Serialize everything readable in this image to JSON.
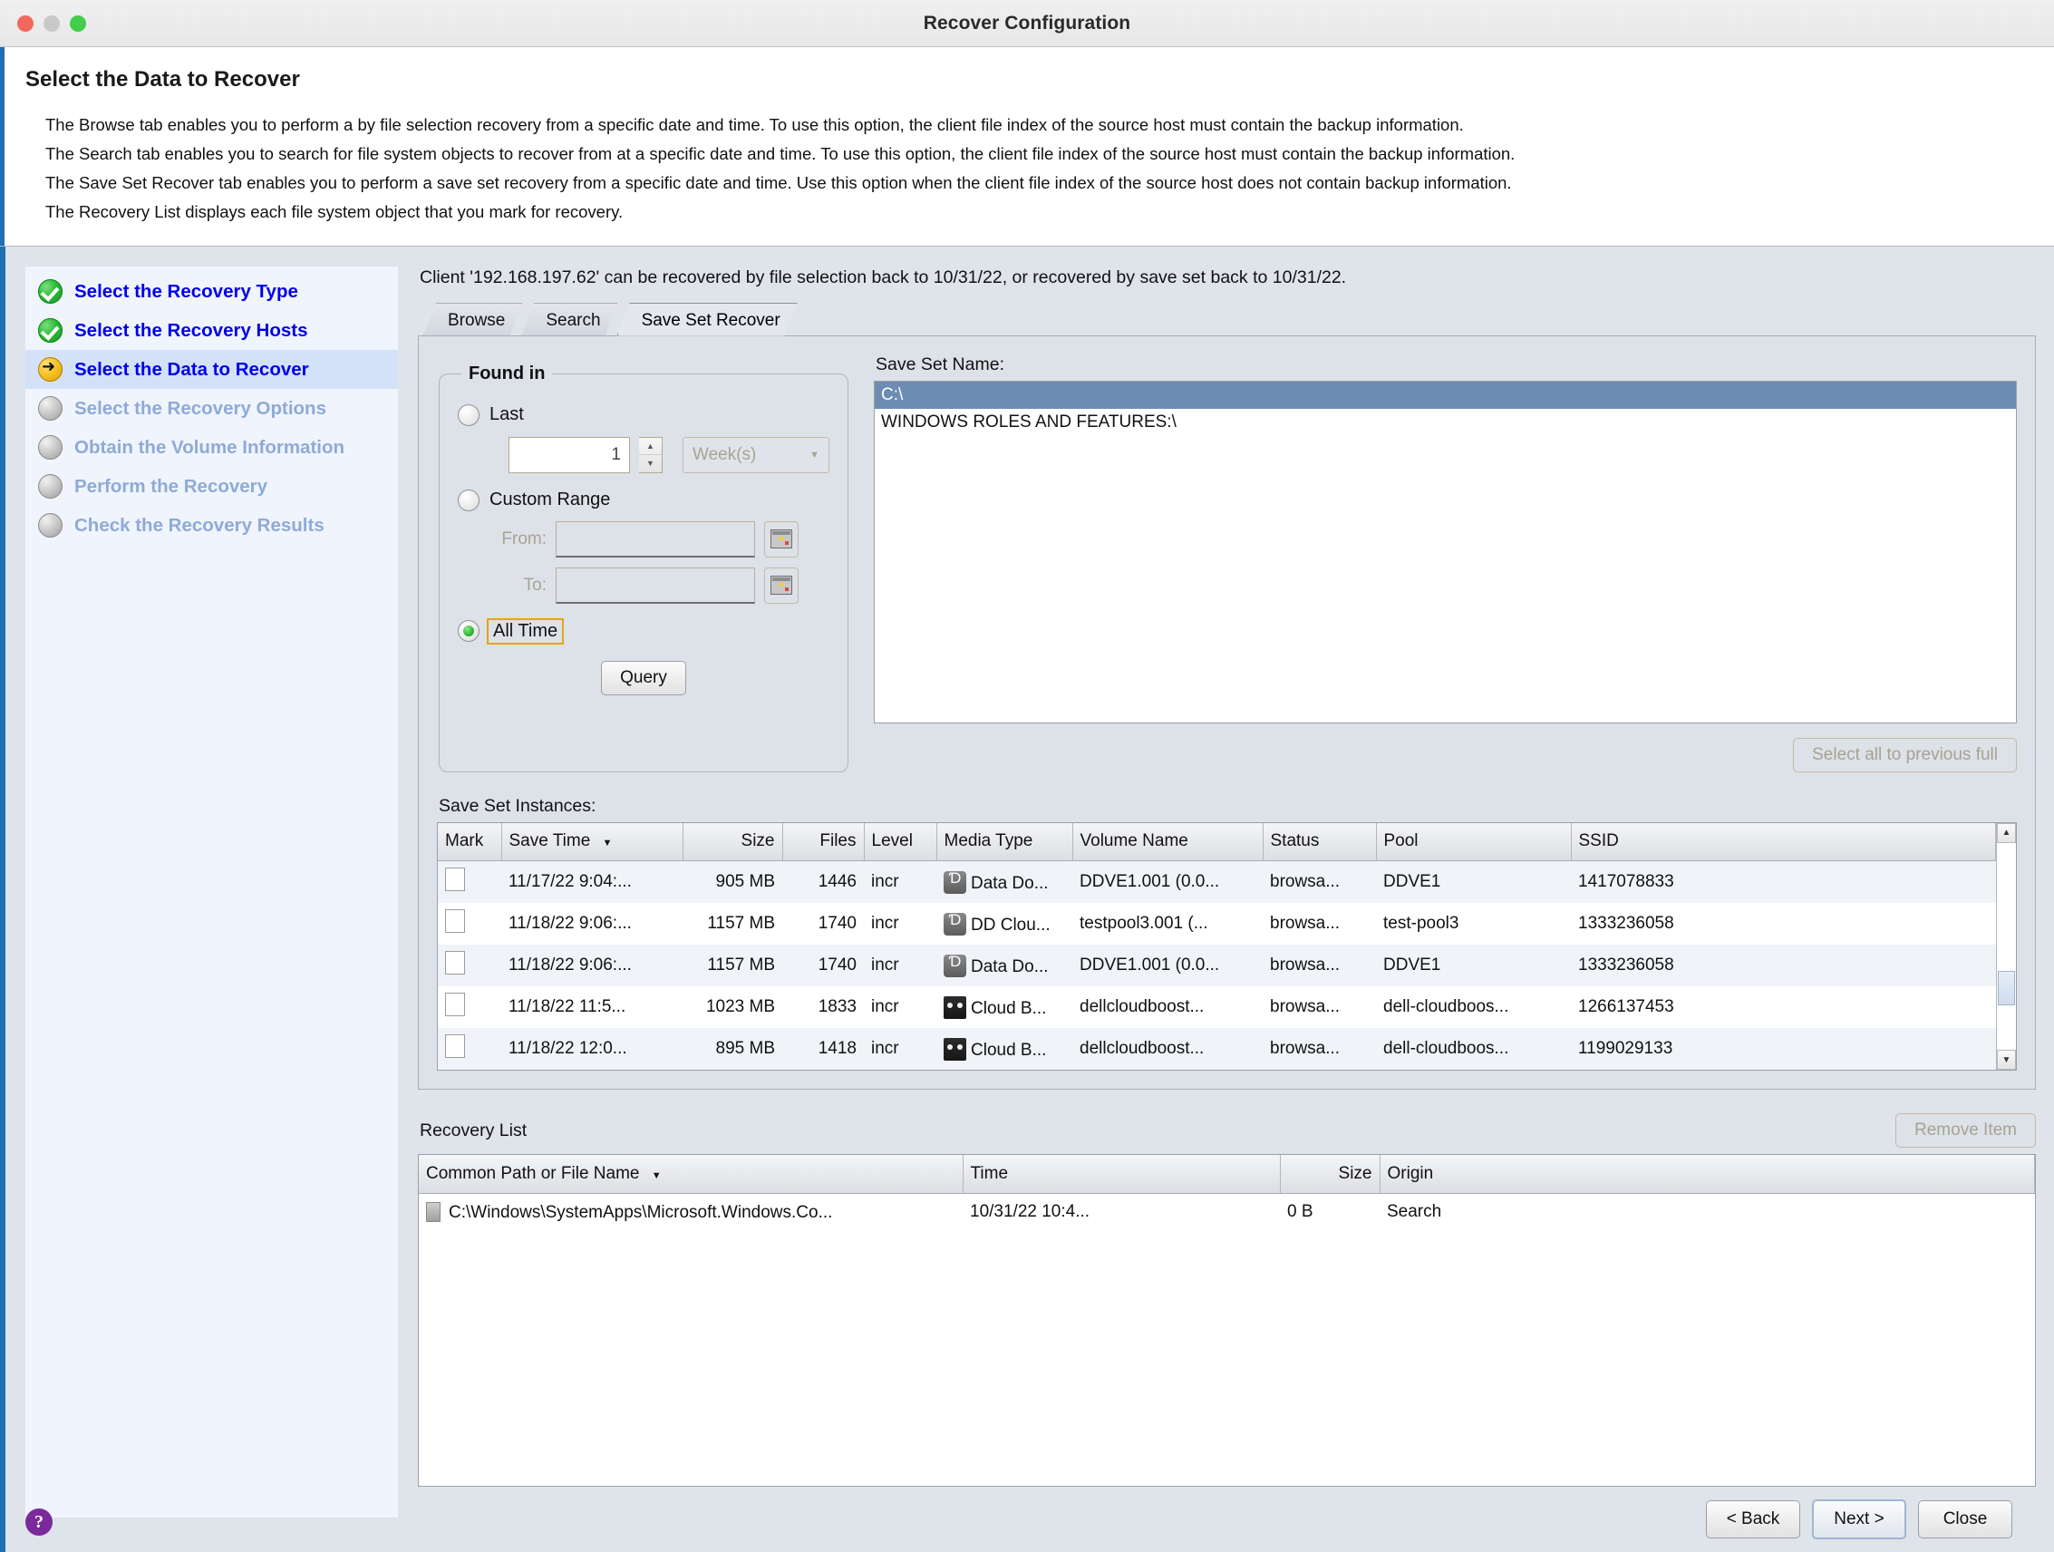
{
  "window": {
    "title": "Recover Configuration"
  },
  "header": {
    "page_title": "Select the Data to Recover",
    "descriptions": [
      "The Browse tab enables you to perform a by file selection recovery from a specific date and time. To use this option, the client file index of the source host must contain the backup information.",
      "The Search tab enables you to search for file system objects to recover from at a specific date and time. To use this option, the client file index of the source host must contain the backup information.",
      "The Save Set Recover tab enables you to perform a save set recovery from a specific date and time.  Use this option when the client file index of the source host does not contain backup information.",
      "The Recovery List displays each file system object that you mark for recovery."
    ]
  },
  "sidebar": {
    "items": [
      {
        "label": "Select the Recovery Type",
        "state": "done"
      },
      {
        "label": "Select the Recovery Hosts",
        "state": "done"
      },
      {
        "label": "Select the Data to Recover",
        "state": "active"
      },
      {
        "label": "Select the Recovery Options",
        "state": "pending"
      },
      {
        "label": "Obtain the Volume Information",
        "state": "pending"
      },
      {
        "label": "Perform the Recovery",
        "state": "pending"
      },
      {
        "label": "Check the Recovery Results",
        "state": "pending"
      }
    ],
    "help_glyph": "?"
  },
  "main": {
    "client_line": "Client '192.168.197.62' can be recovered by file selection back to 10/31/22, or recovered by save set back to 10/31/22.",
    "tabs": [
      {
        "label": "Browse",
        "active": false
      },
      {
        "label": "Search",
        "active": false
      },
      {
        "label": "Save Set Recover",
        "active": true
      }
    ],
    "found_in": {
      "legend": "Found in",
      "last_label": "Last",
      "last_value": "1",
      "unit_value": "Week(s)",
      "custom_range_label": "Custom Range",
      "from_label": "From:",
      "from_value": "",
      "to_label": "To:",
      "to_value": "",
      "all_time_label": "All Time",
      "selected": "All Time",
      "query_button": "Query"
    },
    "save_set_name": {
      "label": "Save Set Name:",
      "items": [
        "C:\\",
        "WINDOWS ROLES AND FEATURES:\\"
      ],
      "selected_index": 0
    },
    "select_all_button": "Select all to previous full",
    "instances": {
      "label": "Save Set Instances:",
      "columns": [
        "Mark",
        "Save Time",
        "Size",
        "Files",
        "Level",
        "Media Type",
        "Volume Name",
        "Status",
        "Pool",
        "SSID"
      ],
      "sort_column": "Save Time",
      "sort_arrow": "▼",
      "rows": [
        {
          "mark": false,
          "save_time": "11/17/22 9:04:...",
          "size": "905 MB",
          "files": "1446",
          "level": "incr",
          "media_type": "Data Do...",
          "media_icon": "dd-icon",
          "volume_name": "DDVE1.001 (0.0...",
          "status": "browsa...",
          "pool": "DDVE1",
          "ssid": "1417078833"
        },
        {
          "mark": false,
          "save_time": "11/18/22 9:06:...",
          "size": "1157 MB",
          "files": "1740",
          "level": "incr",
          "media_type": "DD Clou...",
          "media_icon": "dd-icon",
          "volume_name": "testpool3.001 (...",
          "status": "browsa...",
          "pool": "test-pool3",
          "ssid": "1333236058"
        },
        {
          "mark": false,
          "save_time": "11/18/22 9:06:...",
          "size": "1157 MB",
          "files": "1740",
          "level": "incr",
          "media_type": "Data Do...",
          "media_icon": "dd-icon",
          "volume_name": "DDVE1.001 (0.0...",
          "status": "browsa...",
          "pool": "DDVE1",
          "ssid": "1333236058"
        },
        {
          "mark": false,
          "save_time": "11/18/22 11:5...",
          "size": "1023 MB",
          "files": "1833",
          "level": "incr",
          "media_type": "Cloud B...",
          "media_icon": "tape-icon",
          "volume_name": "dellcloudboost...",
          "status": "browsa...",
          "pool": "dell-cloudboos...",
          "ssid": "1266137453"
        },
        {
          "mark": false,
          "save_time": "11/18/22 12:0...",
          "size": "895 MB",
          "files": "1418",
          "level": "incr",
          "media_type": "Cloud B...",
          "media_icon": "tape-icon",
          "volume_name": "dellcloudboost...",
          "status": "browsa...",
          "pool": "dell-cloudboos...",
          "ssid": "1199029133"
        }
      ]
    },
    "recovery_list": {
      "title": "Recovery List",
      "remove_button": "Remove Item",
      "columns": [
        "Common Path or File Name",
        "Time",
        "Size",
        "Origin"
      ],
      "sort_column": "Common Path or File Name",
      "sort_arrow": "▼",
      "rows": [
        {
          "path": "C:\\Windows\\SystemApps\\Microsoft.Windows.Co...",
          "time": "10/31/22 10:4...",
          "size": "0 B",
          "origin": "Search"
        }
      ]
    }
  },
  "footer": {
    "back": "< Back",
    "next": "Next >",
    "close": "Close"
  },
  "colors": {
    "accent_blue": "#1f6fb2",
    "link_blue": "#0000e8",
    "muted_blue": "#8faad6",
    "selection_blue": "#6c8cb4",
    "focus_orange": "#e8a317",
    "help_purple": "#7b2a9b"
  }
}
